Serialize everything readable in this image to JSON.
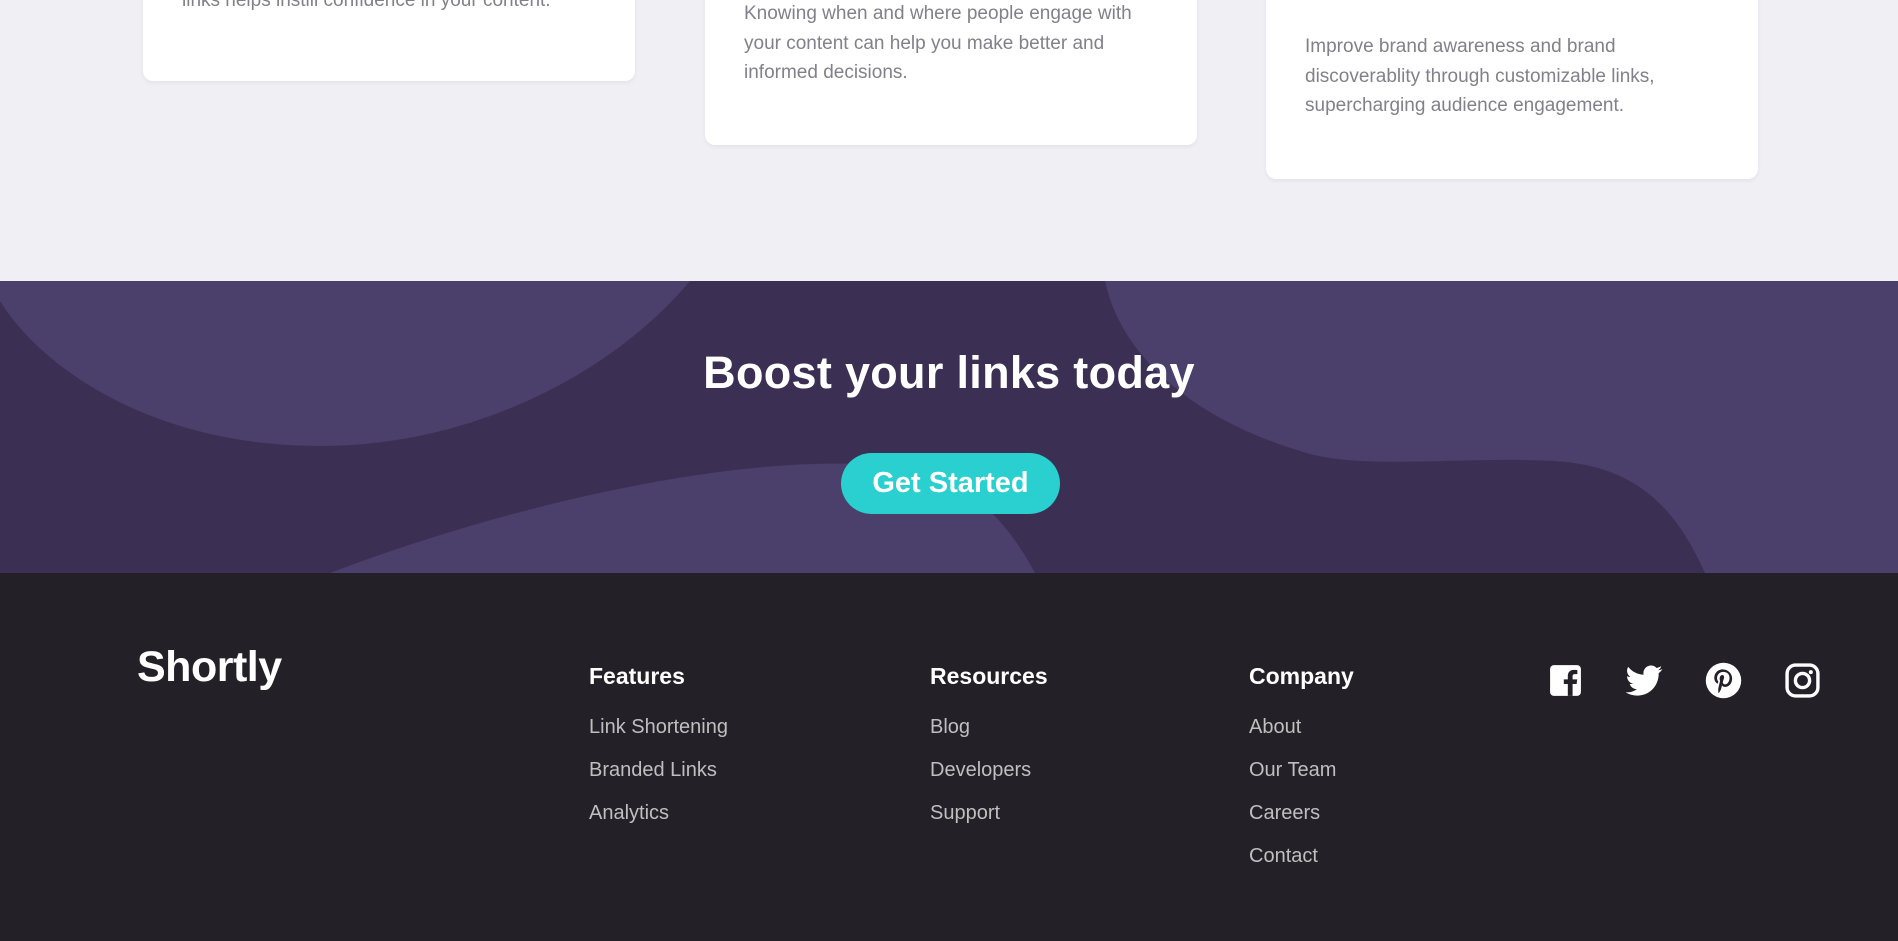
{
  "cards": [
    {
      "text": "links helps instill confidence in your content."
    },
    {
      "text": "Knowing when and where people engage with your content can help you make better and informed decisions."
    },
    {
      "text": "Improve brand awareness and brand discoverablity through customizable links, supercharging audience engagement."
    }
  ],
  "boost": {
    "title": "Boost your links today",
    "cta_label": "Get Started"
  },
  "footer": {
    "logo": "Shortly",
    "columns": [
      {
        "title": "Features",
        "links": [
          "Link Shortening",
          "Branded Links",
          "Analytics"
        ]
      },
      {
        "title": "Resources",
        "links": [
          "Blog",
          "Developers",
          "Support"
        ]
      },
      {
        "title": "Company",
        "links": [
          "About",
          "Our Team",
          "Careers",
          "Contact"
        ]
      }
    ],
    "socials": [
      "facebook-icon",
      "twitter-icon",
      "pinterest-icon",
      "instagram-icon"
    ]
  },
  "colors": {
    "page_bg": "#efeff4",
    "card_bg": "#ffffff",
    "boost_bg": "#3b3054",
    "boost_shape": "#4b3f6b",
    "cta": "#2acfcf",
    "footer_bg": "#232127",
    "footer_link": "#bfbfbf"
  }
}
